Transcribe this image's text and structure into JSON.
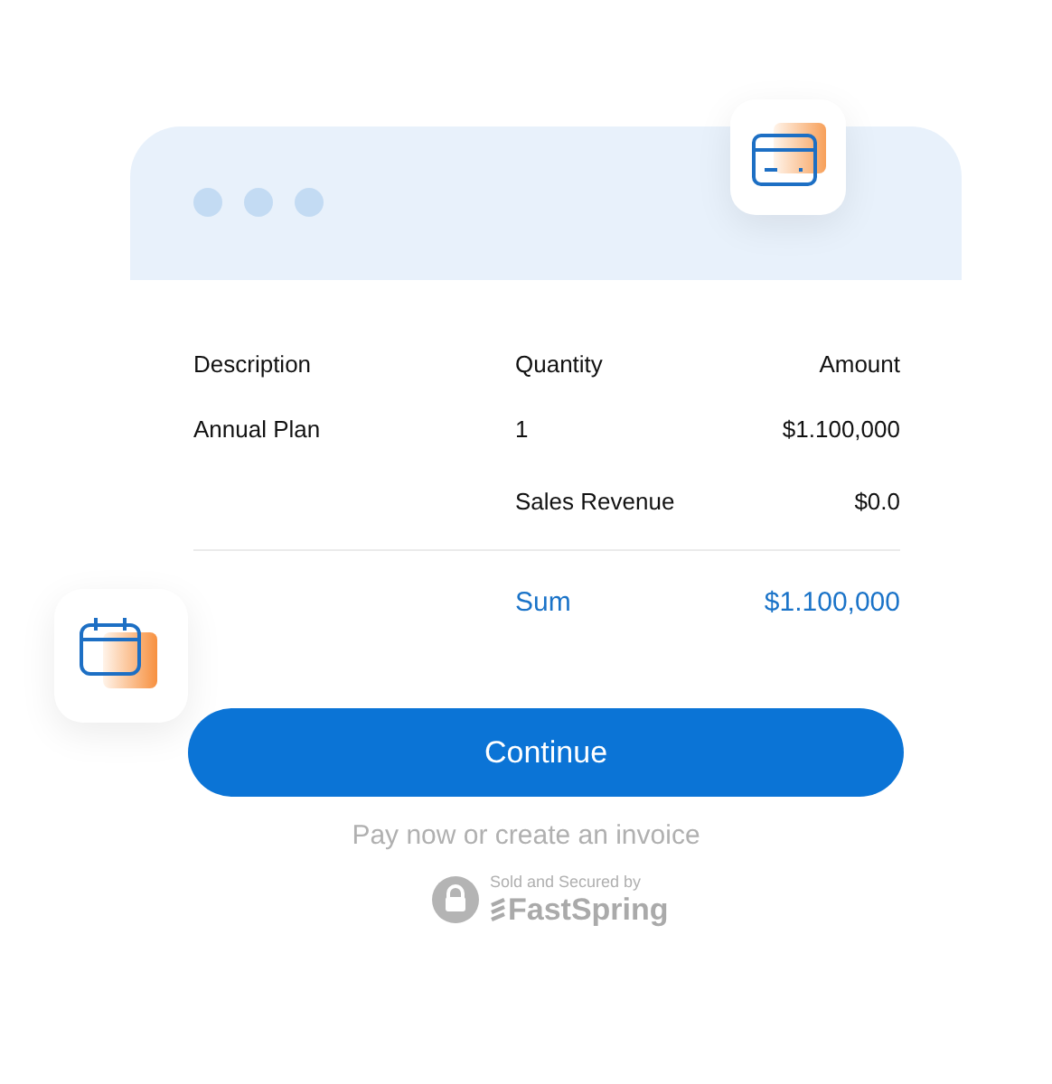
{
  "table": {
    "columns": [
      "Description",
      "Quantity",
      "Amount"
    ],
    "rows": [
      [
        "Annual Plan",
        "1",
        "$1.100,000"
      ],
      [
        "",
        "Sales Revenue",
        "$0.0"
      ]
    ],
    "total": {
      "label": "Sum",
      "value": "$1.100,000"
    }
  },
  "button": {
    "label": "Continue"
  },
  "footer": {
    "text": "Pay now or create an invoice",
    "secured_label": "Sold and Secured by",
    "brand": "FastSpring"
  }
}
